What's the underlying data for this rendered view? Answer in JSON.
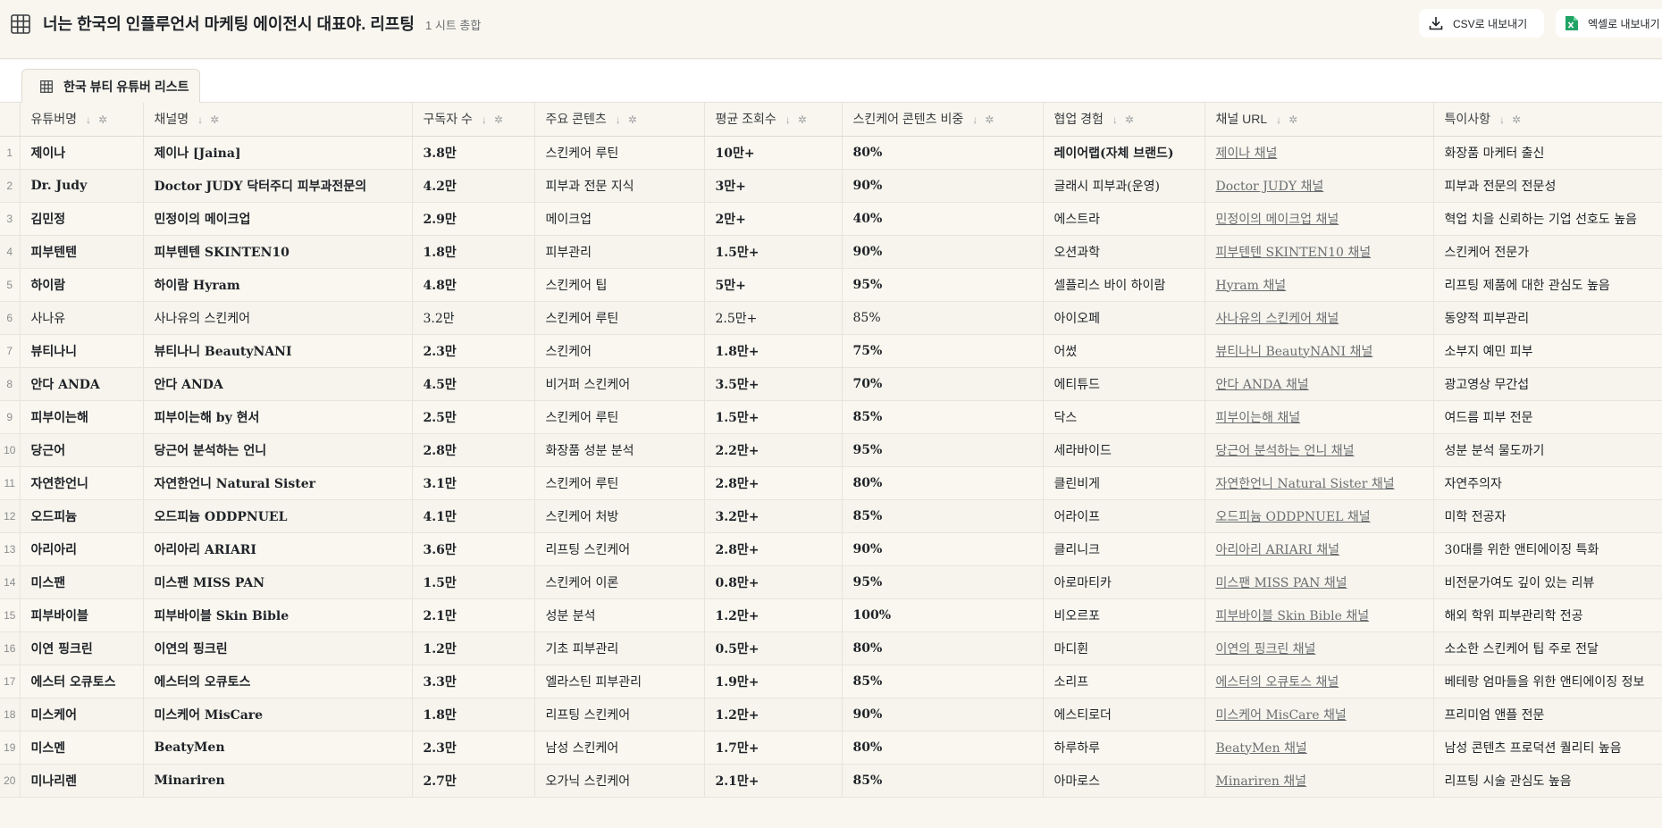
{
  "header": {
    "title": "너는 한국의 인플루언서 마케팅 에이전시 대표야. 리프팅",
    "subtitle": "1 시트 총합",
    "csv_label": "CSV로 내보내기",
    "excel_label": "엑셀로 내보내기"
  },
  "tabs": [
    {
      "label": "한국 뷰티 유튜버 리스트"
    }
  ],
  "table": {
    "columns": [
      "유튜버명",
      "채널명",
      "구독자 수",
      "주요 콘텐츠",
      "평균 조회수",
      "스킨케어 콘텐츠 비중",
      "협업 경험",
      "채널 URL",
      "특이사항"
    ],
    "rows": [
      {
        "num": "1",
        "bold": true,
        "cells": [
          "제이나",
          "제이나 [Jaina]",
          "3.8만",
          "스킨케어 루틴",
          "10만+",
          "80%",
          "레이어랩(자체 브랜드)",
          "제이나 채널",
          "화장품 마케터 출신"
        ]
      },
      {
        "num": "2",
        "bold": true,
        "cells": [
          "Dr. Judy",
          "Doctor JUDY 닥터주디 피부과전문의",
          "4.2만",
          "피부과 전문 지식",
          "3만+",
          "90%",
          "글래시 피부과(운영)",
          "Doctor JUDY 채널",
          "피부과 전문의 전문성"
        ]
      },
      {
        "num": "3",
        "bold": true,
        "cells": [
          "김민정",
          "민정이의 메이크업",
          "2.9만",
          "메이크업",
          "2만+",
          "40%",
          "에스트라",
          "민정이의 메이크업 채널",
          "혁업 치을 신뢰하는 기업 선호도 높음"
        ]
      },
      {
        "num": "4",
        "bold": true,
        "cells": [
          "피부텐텐",
          "피부텐텐 SKINTEN10",
          "1.8만",
          "피부관리",
          "1.5만+",
          "90%",
          "오션과학",
          "피부텐텐 SKINTEN10 채널",
          "스킨케어 전문가"
        ]
      },
      {
        "num": "5",
        "bold": true,
        "cells": [
          "하이람",
          "하이람 Hyram",
          "4.8만",
          "스킨케어 팁",
          "5만+",
          "95%",
          "셀플리스 바이 하이람",
          "Hyram 채널",
          "리프팅 제품에 대한 관심도 높음"
        ]
      },
      {
        "num": "6",
        "bold": false,
        "cells": [
          "사나유",
          "사나유의 스킨케어",
          "3.2만",
          "스킨케어 루틴",
          "2.5만+",
          "85%",
          "아이오페",
          "사나유의 스킨케어 채널",
          "동양적 피부관리"
        ]
      },
      {
        "num": "7",
        "bold": true,
        "cells": [
          "뷰티나니",
          "뷰티나니 BeautyNANI",
          "2.3만",
          "스킨케어",
          "1.8만+",
          "75%",
          "어썼",
          "뷰티나니 BeautyNANI 채널",
          "소부지 예민 피부"
        ]
      },
      {
        "num": "8",
        "bold": true,
        "cells": [
          "안다 ANDA",
          "안다 ANDA",
          "4.5만",
          "비거퍼 스킨케어",
          "3.5만+",
          "70%",
          "에티튜드",
          "안다 ANDA 채널",
          "광고영상 무간섭"
        ]
      },
      {
        "num": "9",
        "bold": true,
        "cells": [
          "피부이는해",
          "피부이는해 by 현서",
          "2.5만",
          "스킨케어 루틴",
          "1.5만+",
          "85%",
          "닥스",
          "피부이는해 채널",
          "여드름 피부 전문"
        ]
      },
      {
        "num": "10",
        "bold": true,
        "cells": [
          "당근어",
          "당근어 분석하는 언니",
          "2.8만",
          "화장품 성분 분석",
          "2.2만+",
          "95%",
          "세라바이드",
          "당근어 분석하는 언니 채널",
          "성분 분석 물도까기"
        ]
      },
      {
        "num": "11",
        "bold": true,
        "cells": [
          "자연한언니",
          "자연한언니 Natural Sister",
          "3.1만",
          "스킨케어 루틴",
          "2.8만+",
          "80%",
          "클린비게",
          "자연한언니 Natural Sister 채널",
          "자연주의자"
        ]
      },
      {
        "num": "12",
        "bold": true,
        "cells": [
          "오드피늄",
          "오드피늄 ODDPNUEL",
          "4.1만",
          "스킨케어 처방",
          "3.2만+",
          "85%",
          "어라이프",
          "오드피늄 ODDPNUEL 채널",
          "미학 전공자"
        ]
      },
      {
        "num": "13",
        "bold": true,
        "cells": [
          "아리아리",
          "아리아리 ARIARI",
          "3.6만",
          "리프팅 스킨케어",
          "2.8만+",
          "90%",
          "클리니크",
          "아리아리 ARIARI 채널",
          "30대를 위한 앤티에이징 특화"
        ]
      },
      {
        "num": "14",
        "bold": true,
        "cells": [
          "미스팬",
          "미스팬 MISS PAN",
          "1.5만",
          "스킨케어 이론",
          "0.8만+",
          "95%",
          "아로마티카",
          "미스팬 MISS PAN 채널",
          "비전문가여도 깊이 있는 리뷰"
        ]
      },
      {
        "num": "15",
        "bold": true,
        "cells": [
          "피부바이블",
          "피부바이블 Skin Bible",
          "2.1만",
          "성분 분석",
          "1.2만+",
          "100%",
          "비오르포",
          "피부바이블 Skin Bible 채널",
          "해외 학위 피부관리학 전공"
        ]
      },
      {
        "num": "16",
        "bold": true,
        "cells": [
          "이연 핑크린",
          "이연의 핑크린",
          "1.2만",
          "기초 피부관리",
          "0.5만+",
          "80%",
          "마디휜",
          "이연의 핑크린 채널",
          "소소한 스킨케어 팁 주로 전달"
        ]
      },
      {
        "num": "17",
        "bold": true,
        "cells": [
          "에스터 오큐토스",
          "에스터의 오큐토스",
          "3.3만",
          "엘라스틴 피부관리",
          "1.9만+",
          "85%",
          "소리프",
          "에스터의 오큐토스 채널",
          "베테랑 엄마들을 위한 앤티에이징 정보"
        ]
      },
      {
        "num": "18",
        "bold": true,
        "cells": [
          "미스케어",
          "미스케어 MisCare",
          "1.8만",
          "리프팅 스킨케어",
          "1.2만+",
          "90%",
          "에스티로더",
          "미스케어 MisCare 채널",
          "프리미엄 앤플 전문"
        ]
      },
      {
        "num": "19",
        "bold": true,
        "cells": [
          "미스멘",
          "BeatyMen",
          "2.3만",
          "남성 스킨케어",
          "1.7만+",
          "80%",
          "하루하루",
          "BeatyMen 채널",
          "남성 콘텐츠 프로덕션 퀄리티 높음"
        ]
      },
      {
        "num": "20",
        "bold": true,
        "cells": [
          "미나리렌",
          "Minariren",
          "2.7만",
          "오가닉 스킨케어",
          "2.1만+",
          "85%",
          "아마로스",
          "Minariren 채널",
          "리프팅 시술 관심도 높음"
        ]
      }
    ]
  }
}
